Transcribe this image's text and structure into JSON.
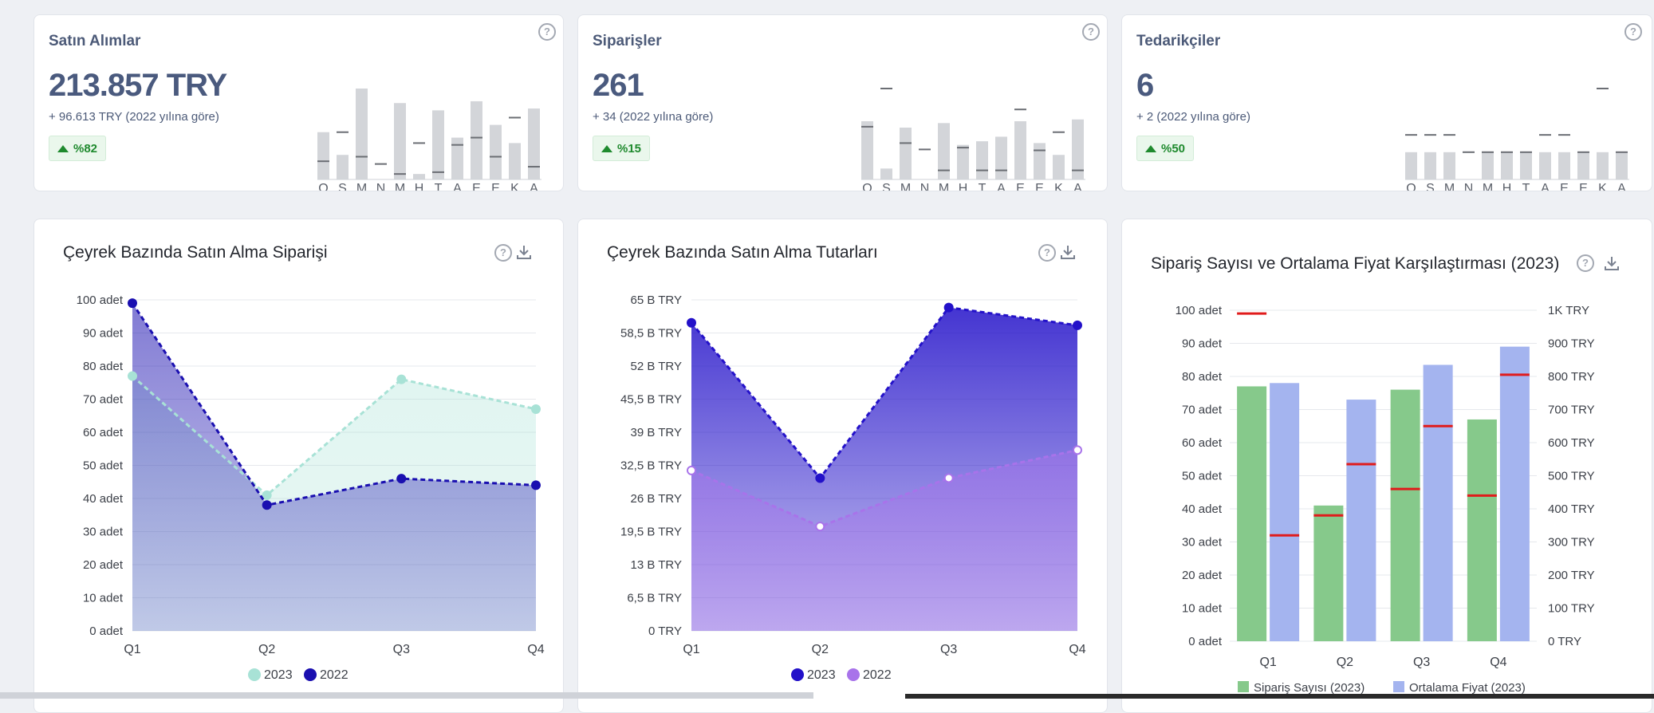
{
  "kpis": [
    {
      "title": "Satın Alımlar",
      "value": "213.857 TRY",
      "sub": "+ 96.613 TRY (2022 yılına göre)",
      "badge": "%82",
      "months": [
        "O",
        "Ş",
        "M",
        "N",
        "M",
        "H",
        "T",
        "A",
        "E",
        "E",
        "K",
        "A"
      ],
      "bars": [
        0.52,
        0.27,
        1.0,
        0.0,
        0.84,
        0.06,
        0.76,
        0.46,
        0.86,
        0.6,
        0.4,
        0.78
      ],
      "marks": [
        0.2,
        0.52,
        0.25,
        0.17,
        0.06,
        0.4,
        0.08,
        0.38,
        0.46,
        0.25,
        0.68,
        0.14
      ]
    },
    {
      "title": "Siparişler",
      "value": "261",
      "sub": "+ 34 (2022 yılına göre)",
      "badge": "%15",
      "months": [
        "O",
        "Ş",
        "M",
        "N",
        "M",
        "H",
        "T",
        "A",
        "E",
        "E",
        "K",
        "A"
      ],
      "bars": [
        0.64,
        0.12,
        0.57,
        0.0,
        0.62,
        0.38,
        0.42,
        0.47,
        0.64,
        0.4,
        0.27,
        0.66
      ],
      "marks": [
        0.58,
        1.0,
        0.4,
        0.33,
        0.1,
        0.35,
        0.1,
        0.1,
        0.77,
        0.32,
        0.52,
        0.1
      ]
    },
    {
      "title": "Tedarikçiler",
      "value": "6",
      "sub": "+ 2 (2022 yılına göre)",
      "badge": "%50",
      "months": [
        "O",
        "Ş",
        "M",
        "N",
        "M",
        "H",
        "T",
        "A",
        "E",
        "E",
        "K",
        "A"
      ],
      "bars": [
        0.3,
        0.3,
        0.3,
        0.0,
        0.3,
        0.3,
        0.3,
        0.3,
        0.3,
        0.3,
        0.3,
        0.3
      ],
      "marks": [
        0.49,
        0.49,
        0.49,
        0.3,
        0.3,
        0.3,
        0.3,
        0.49,
        0.49,
        0.3,
        1.0,
        0.3
      ]
    }
  ],
  "chart_data": [
    {
      "type": "area",
      "title": "Çeyrek Bazında Satın Alma Siparişi",
      "categories": [
        "Q1",
        "Q2",
        "Q3",
        "Q4"
      ],
      "yticks": [
        "0 adet",
        "10 adet",
        "20 adet",
        "30 adet",
        "40 adet",
        "50 adet",
        "60 adet",
        "70 adet",
        "80 adet",
        "90 adet",
        "100 adet"
      ],
      "ylim": [
        0,
        100
      ],
      "series": [
        {
          "name": "2023",
          "values": [
            77,
            41,
            76,
            67
          ],
          "color": "#a8e2d6"
        },
        {
          "name": "2022",
          "values": [
            99,
            38,
            46,
            44
          ],
          "color": "#1a0fb0"
        }
      ],
      "legend": [
        "2023",
        "2022"
      ]
    },
    {
      "type": "area",
      "title": "Çeyrek Bazında Satın Alma Tutarları",
      "categories": [
        "Q1",
        "Q2",
        "Q3",
        "Q4"
      ],
      "yticks": [
        "0 TRY",
        "6,5 B TRY",
        "13 B TRY",
        "19,5 B TRY",
        "26 B TRY",
        "32,5 B TRY",
        "39 B TRY",
        "45,5 B TRY",
        "52 B TRY",
        "58,5 B TRY",
        "65 B TRY"
      ],
      "ylim": [
        0,
        65
      ],
      "series": [
        {
          "name": "2023",
          "values": [
            60.5,
            30.0,
            63.5,
            60.0
          ],
          "color": "#2311c9"
        },
        {
          "name": "2022",
          "values": [
            31.5,
            20.5,
            30.0,
            35.5
          ],
          "color": "#a873ea"
        }
      ],
      "legend": [
        "2023",
        "2022"
      ]
    },
    {
      "type": "bar",
      "title": "Sipariş Sayısı ve Ortalama Fiyat Karşılaştırması (2023)",
      "categories": [
        "Q1",
        "Q2",
        "Q3",
        "Q4"
      ],
      "yticks_left": [
        "0 adet",
        "10 adet",
        "20 adet",
        "30 adet",
        "40 adet",
        "50 adet",
        "60 adet",
        "70 adet",
        "80 adet",
        "90 adet",
        "100 adet"
      ],
      "yticks_right": [
        "0 TRY",
        "100 TRY",
        "200 TRY",
        "300 TRY",
        "400 TRY",
        "500 TRY",
        "600 TRY",
        "700 TRY",
        "800 TRY",
        "900 TRY",
        "1K TRY"
      ],
      "ylim_left": [
        0,
        100
      ],
      "ylim_right": [
        0,
        1000
      ],
      "series": [
        {
          "name": "Sipariş Sayısı (2023)",
          "values": [
            77,
            41,
            76,
            67
          ],
          "color": "#86c98b"
        },
        {
          "name": "Ortalama Fiyat (2023)",
          "values": [
            780,
            730,
            835,
            890
          ],
          "color": "#a4b4ef"
        }
      ],
      "markers": {
        "color": "#e01b1b",
        "on_count_bars": [
          99,
          38,
          46,
          44
        ],
        "on_price_bars": [
          320,
          535,
          650,
          805
        ]
      },
      "legend": [
        "Sipariş Sayısı (2023)",
        "Ortalama Fiyat (2023)"
      ]
    }
  ],
  "icons": {
    "help": "?",
    "download": "download-icon"
  }
}
